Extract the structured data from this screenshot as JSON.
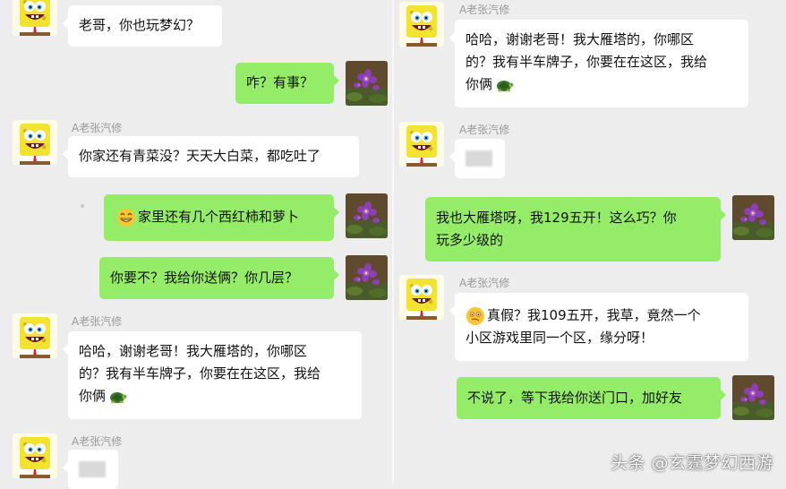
{
  "left": {
    "m1": {
      "text": "老哥，你也玩梦幻？"
    },
    "m2": {
      "text": "咋？有事？"
    },
    "m3": {
      "sender": "A老张汽修",
      "text": "你家还有青菜没？天天大白菜，都吃吐了"
    },
    "m4": {
      "text": "家里还有几个西红柿和萝卜"
    },
    "m5": {
      "text": "你要不？我给你送俩？你几层？"
    },
    "m6": {
      "sender": "A老张汽修",
      "lines": [
        "哈哈，谢谢老哥！我大雁塔的，你哪区",
        "的？我有半车牌子，你要在在这区，我给",
        "你俩"
      ]
    },
    "m7": {
      "sender": "A老张汽修"
    }
  },
  "right": {
    "m1": {
      "sender": "A老张汽修",
      "lines": [
        "哈哈，谢谢老哥！我大雁塔的，你哪区",
        "的？我有半车牌子，你要在在这区，我给",
        "你俩"
      ]
    },
    "m2": {
      "sender": "A老张汽修"
    },
    "m3": {
      "lines": [
        "我也大雁塔呀，我129五开！这么巧？你",
        "玩多少级的"
      ]
    },
    "m4": {
      "sender": "A老张汽修",
      "lines": [
        "真假？我109五开，我草，竟然一个",
        "小区游戏里同一个区，缘分呀！"
      ]
    },
    "m5": {
      "text": "不说了，等下我给你送门口，加好友"
    }
  },
  "watermark": "头条 @玄霆梦幻西游",
  "colors": {
    "background": "#ededed",
    "incoming_bubble": "#ffffff",
    "outgoing_bubble": "#95ec69",
    "sender_name": "#9a9a9a"
  },
  "icons": {
    "incoming_avatar": "spongebob-avatar-icon",
    "outgoing_avatar": "purple-flower-avatar-icon",
    "grin_emoji": "grinning-emoji-icon",
    "turtle_emoji": "turtle-emoji-icon",
    "doubt_emoji": "doubtful-emoji-icon"
  }
}
